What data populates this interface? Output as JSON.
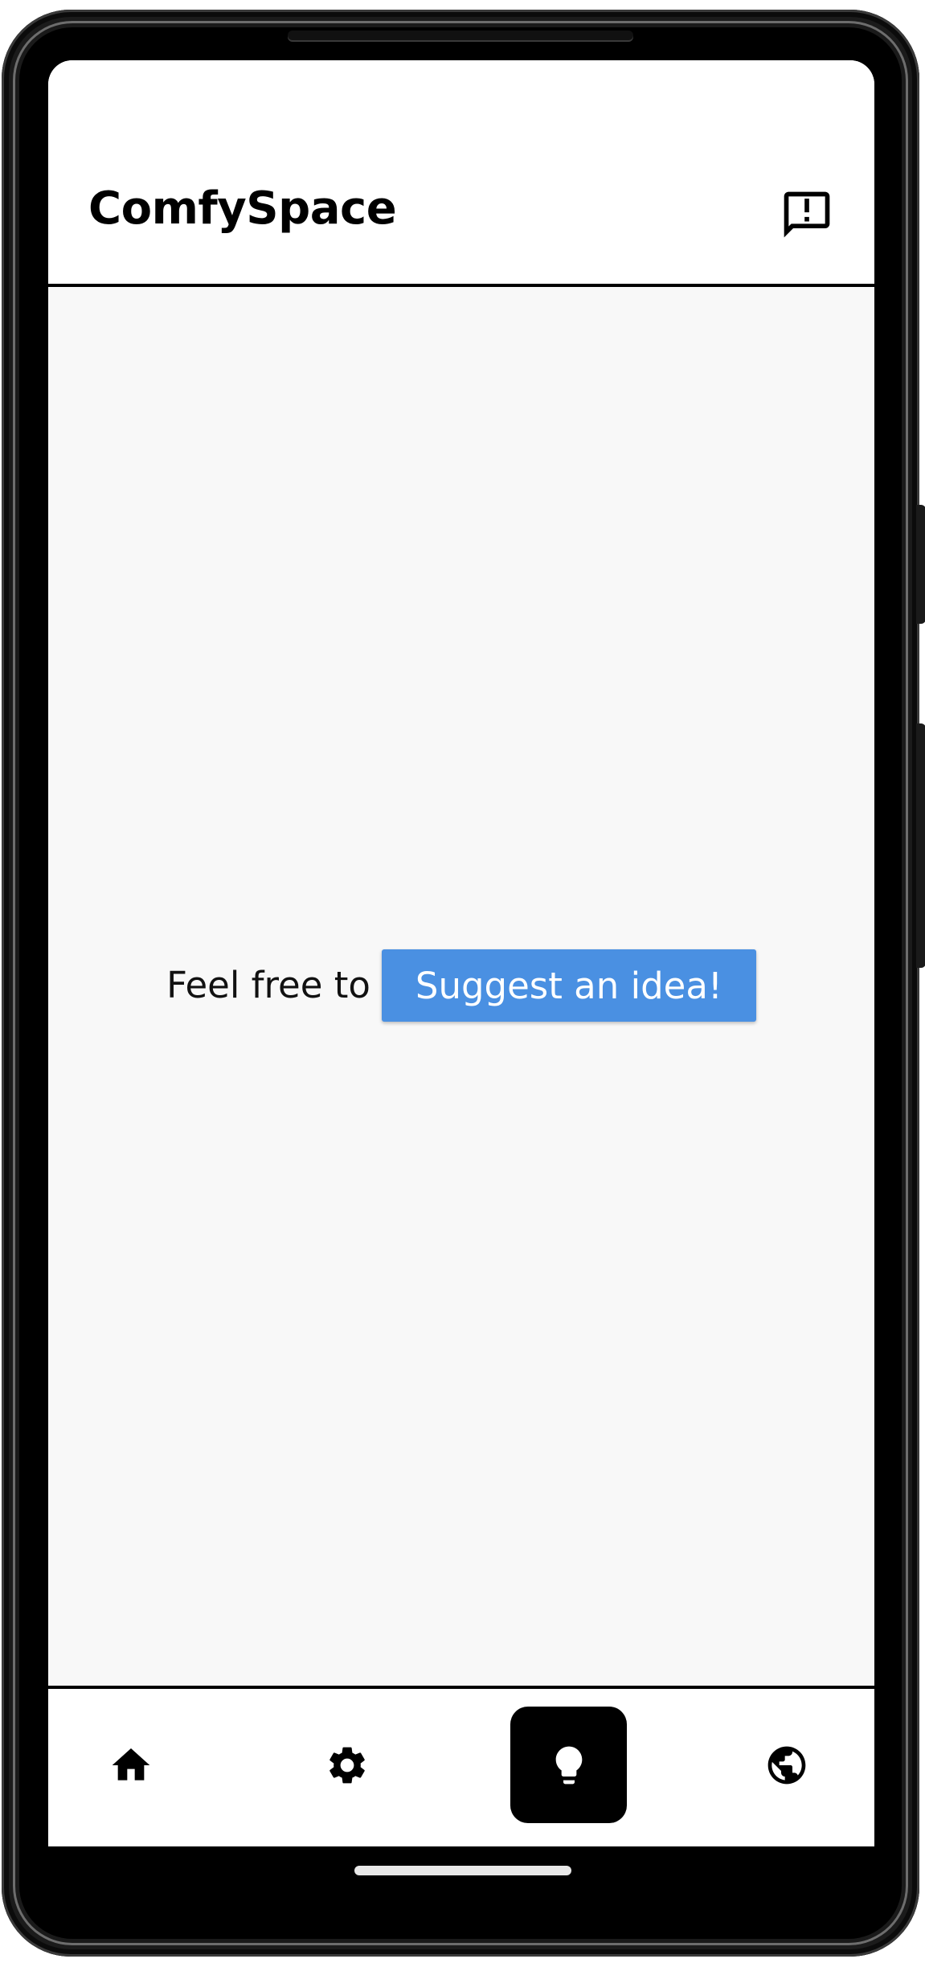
{
  "app": {
    "title": "ComfySpace",
    "feedback_icon": "feedback-icon"
  },
  "main": {
    "prompt_text": "Feel free to",
    "cta_label": "Suggest an idea!",
    "cta_color": "#4a90e2",
    "background_color": "#f8f8f8"
  },
  "bottom_nav": {
    "items": [
      {
        "icon": "home-icon",
        "active": false
      },
      {
        "icon": "settings-gear-icon",
        "active": false
      },
      {
        "icon": "lightbulb-icon",
        "active": true
      },
      {
        "icon": "globe-icon",
        "active": false
      }
    ],
    "active_color": "#000000"
  }
}
